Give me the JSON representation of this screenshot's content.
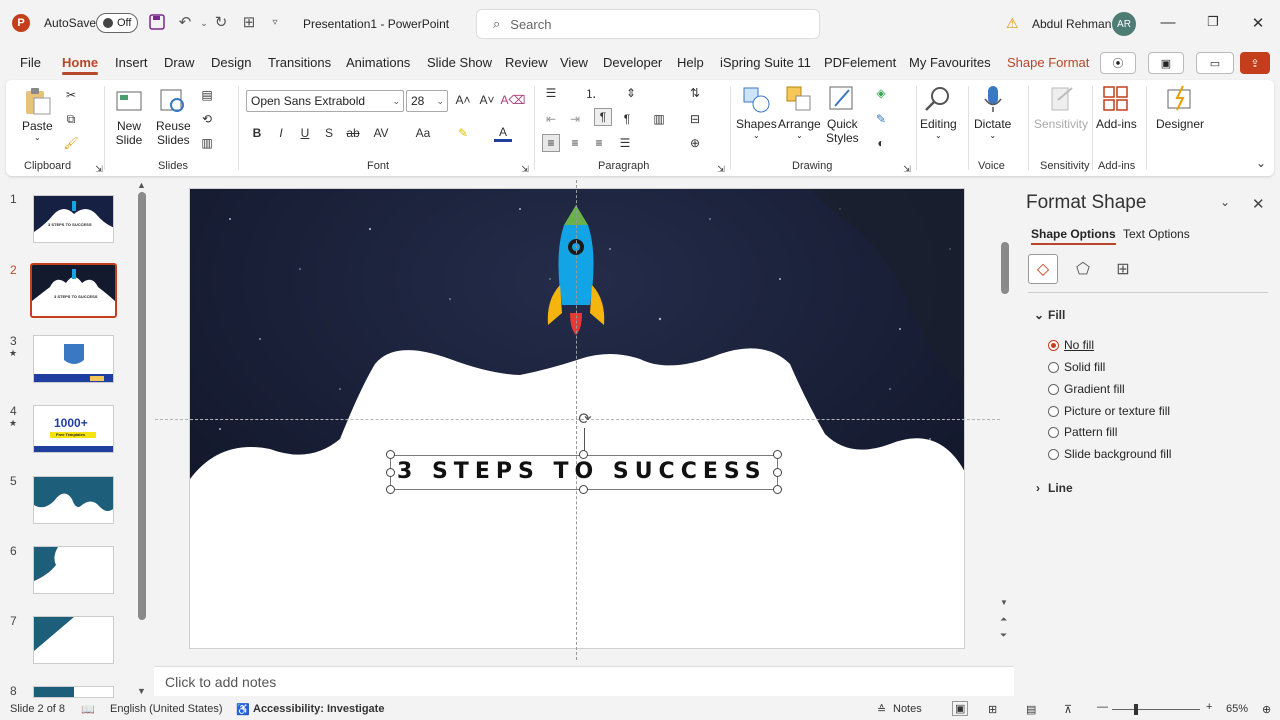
{
  "titlebar": {
    "app_letter": "P",
    "autosave_label": "AutoSave",
    "autosave_state": "Off",
    "doc_title": "Presentation1  -  PowerPoint",
    "search_placeholder": "Search",
    "user_name": "Abdul Rehman",
    "user_initials": "AR"
  },
  "tabs": [
    "File",
    "Home",
    "Insert",
    "Draw",
    "Design",
    "Transitions",
    "Animations",
    "Slide Show",
    "Review",
    "View",
    "Developer",
    "Help",
    "iSpring Suite 11",
    "PDFelement",
    "My Favourites",
    "Shape Format"
  ],
  "ribbon": {
    "clipboard": {
      "paste": "Paste",
      "label": "Clipboard"
    },
    "slides": {
      "new_slide_1": "New",
      "new_slide_2": "Slide",
      "reuse_1": "Reuse",
      "reuse_2": "Slides",
      "label": "Slides"
    },
    "font": {
      "name": "Open Sans Extrabold",
      "size": "28",
      "label": "Font"
    },
    "paragraph": {
      "label": "Paragraph"
    },
    "drawing": {
      "shapes": "Shapes",
      "arrange": "Arrange",
      "quick_styles_1": "Quick",
      "quick_styles_2": "Styles",
      "label": "Drawing"
    },
    "editing": {
      "label_btn": "Editing"
    },
    "voice": {
      "dictate": "Dictate",
      "label": "Voice"
    },
    "sensitivity": {
      "btn": "Sensitivity",
      "label": "Sensitivity"
    },
    "addins": {
      "btn": "Add-ins",
      "label": "Add-ins"
    },
    "designer": {
      "btn": "Designer"
    }
  },
  "thumbnails": {
    "numbers": [
      "1",
      "2",
      "3",
      "4",
      "5",
      "6",
      "7",
      "8"
    ],
    "thumb1_title": "3 STEPS TO SUCCESS",
    "thumb2_title": "3 STEPS TO SUCCESS",
    "thumb4_big": "1000+",
    "thumb4_sub": "Free Templates"
  },
  "slide": {
    "title_text": "3 STEPS TO SUCCESS"
  },
  "notes_placeholder": "Click to add notes",
  "format_pane": {
    "title": "Format Shape",
    "tab_shape": "Shape Options",
    "tab_text": "Text Options",
    "fill_header": "Fill",
    "line_header": "Line",
    "fill_options": [
      "No fill",
      "Solid fill",
      "Gradient fill",
      "Picture or texture fill",
      "Pattern fill",
      "Slide background fill"
    ],
    "selected_fill": "No fill"
  },
  "status": {
    "slide_count": "Slide 2 of 8",
    "language": "English (United States)",
    "accessibility": "Accessibility: Investigate",
    "notes_btn": "Notes",
    "zoom": "65%"
  },
  "colors": {
    "accent": "#b7472a",
    "space": "#141a2e",
    "rocket_body": "#13a4e6",
    "rocket_fins": "#f5b50e",
    "rocket_tip": "#6ab04c",
    "flame": "#e53935",
    "thumb_teal": "#1d5e7a"
  }
}
